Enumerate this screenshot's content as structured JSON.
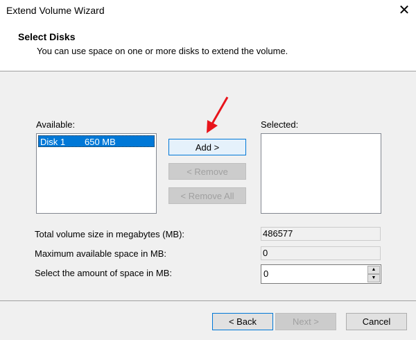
{
  "window": {
    "title": "Extend Volume Wizard",
    "close_icon": "close-icon"
  },
  "header": {
    "heading": "Select Disks",
    "description": "You can use space on one or more disks to extend the volume."
  },
  "available": {
    "label": "Available:",
    "items": [
      {
        "name": "Disk 1",
        "size": "650 MB"
      }
    ]
  },
  "selected": {
    "label": "Selected:"
  },
  "buttons": {
    "add": "Add >",
    "remove": "< Remove",
    "remove_all": "< Remove All",
    "back": "< Back",
    "next": "Next >",
    "cancel": "Cancel"
  },
  "fields": {
    "total_label": "Total volume size in megabytes (MB):",
    "total_value": "486577",
    "max_label": "Maximum available space in MB:",
    "max_value": "0",
    "amount_label": "Select the amount of space in MB:",
    "amount_value": "0"
  },
  "colors": {
    "selection": "#0078d7",
    "annotation_arrow": "#e8141b"
  }
}
